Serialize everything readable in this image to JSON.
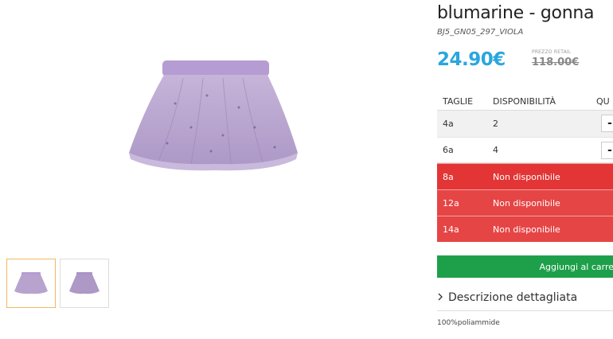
{
  "product": {
    "title": "blumarine - gonna",
    "code": "BJ5_GN05_297_VIOLA",
    "price": "24.90€",
    "retail_label": "PREZZO RETAIL",
    "retail_price": "118.00€"
  },
  "sizes": {
    "headers": {
      "size": "TAGLIE",
      "availability": "DISPONIBILITÀ",
      "quantity": "QU"
    },
    "rows": [
      {
        "size": "4a",
        "availability": "2",
        "qty_button": "-"
      },
      {
        "size": "6a",
        "availability": "4",
        "qty_button": "-"
      },
      {
        "size": "8a",
        "availability": "Non disponibile"
      },
      {
        "size": "12a",
        "availability": "Non disponibile"
      },
      {
        "size": "14a",
        "availability": "Non disponibile"
      }
    ]
  },
  "cart": {
    "label": "Aggiungi al carre"
  },
  "description": {
    "toggle_label": "Descrizione dettagliata",
    "text": "100%poliammide"
  },
  "colors": {
    "price": "#2aa6df",
    "unavailable": "#e64545",
    "cart": "#1ea04a",
    "skirt": "#b8a3cf",
    "thumb_active_border": "#f0b860"
  }
}
